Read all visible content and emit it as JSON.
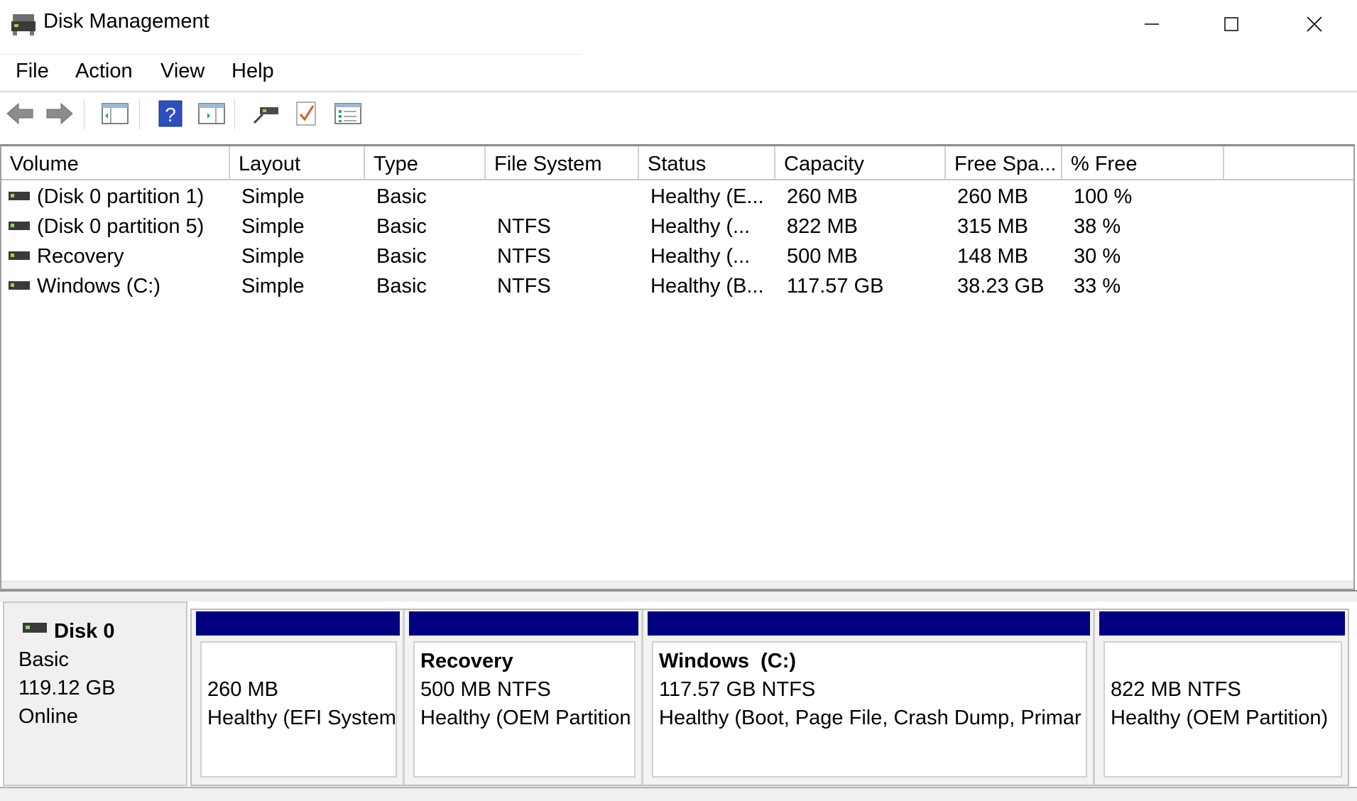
{
  "window": {
    "title": "Disk Management",
    "app_icon": "disk-management-icon",
    "controls": [
      "minimize-icon",
      "maximize-icon",
      "close-icon"
    ]
  },
  "menu": [
    "File",
    "Action",
    "View",
    "Help"
  ],
  "toolbar": {
    "buttons": [
      "back-arrow-icon",
      "forward-arrow-icon",
      "show-hide-console-tree-icon",
      "help-icon",
      "show-action-pane-icon",
      "connect-drive-icon",
      "check-icon",
      "properties-list-icon"
    ]
  },
  "volume_list": {
    "columns": [
      "Volume",
      "Layout",
      "Type",
      "File System",
      "Status",
      "Capacity",
      "Free Spa...",
      "% Free"
    ],
    "rows": [
      {
        "volume": "(Disk 0 partition 1)",
        "layout": "Simple",
        "type": "Basic",
        "fs": "",
        "status": "Healthy (E...",
        "capacity": "260 MB",
        "free": "260 MB",
        "pct": "100 %"
      },
      {
        "volume": "(Disk 0 partition 5)",
        "layout": "Simple",
        "type": "Basic",
        "fs": "NTFS",
        "status": "Healthy (...",
        "capacity": "822 MB",
        "free": "315 MB",
        "pct": "38 %"
      },
      {
        "volume": "Recovery",
        "layout": "Simple",
        "type": "Basic",
        "fs": "NTFS",
        "status": "Healthy (...",
        "capacity": "500 MB",
        "free": "148 MB",
        "pct": "30 %"
      },
      {
        "volume": "Windows (C:)",
        "layout": "Simple",
        "type": "Basic",
        "fs": "NTFS",
        "status": "Healthy (B...",
        "capacity": "117.57 GB",
        "free": "38.23 GB",
        "pct": "33 %"
      }
    ]
  },
  "disk": {
    "name": "Disk 0",
    "type": "Basic",
    "size": "119.12 GB",
    "state": "Online",
    "partitions": [
      {
        "title": "",
        "size": "260 MB",
        "status": "Healthy (EFI System"
      },
      {
        "title": "Recovery",
        "size": "500 MB NTFS",
        "status": "Healthy (OEM Partition"
      },
      {
        "title": "Windows  (C:)",
        "size": "117.57 GB NTFS",
        "status": "Healthy (Boot, Page File, Crash Dump, Primar"
      },
      {
        "title": "",
        "size": "822 MB NTFS",
        "status": "Healthy (OEM Partition)"
      }
    ],
    "partition_header_color": "#000080"
  }
}
